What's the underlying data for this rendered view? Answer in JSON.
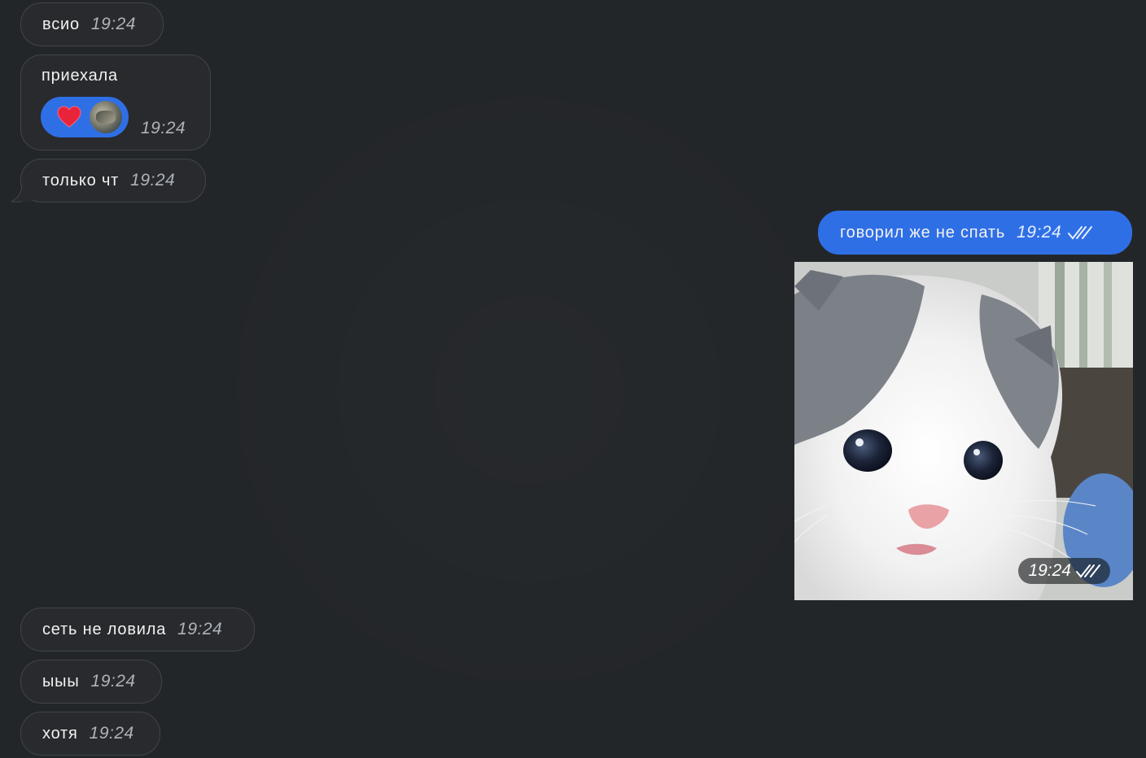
{
  "messages": [
    {
      "text": "всио",
      "time": "19:24"
    },
    {
      "text": "приехала",
      "time": "19:24"
    },
    {
      "text": "только чт",
      "time": "19:24"
    },
    {
      "text": "говорил же не спать",
      "time": "19:24"
    },
    {
      "text": "",
      "time": "19:24"
    },
    {
      "text": "сеть не ловила",
      "time": "19:24"
    },
    {
      "text": "ыыы",
      "time": "19:24"
    },
    {
      "text": "хотя",
      "time": "19:24"
    }
  ],
  "reaction": {
    "emoji": "heart-icon"
  },
  "colors": {
    "background": "#232629",
    "incoming_bubble": "#282a2d",
    "incoming_border": "#41444a",
    "outgoing_bubble": "#2f6fe6",
    "time_text": "#aeb3bb"
  }
}
